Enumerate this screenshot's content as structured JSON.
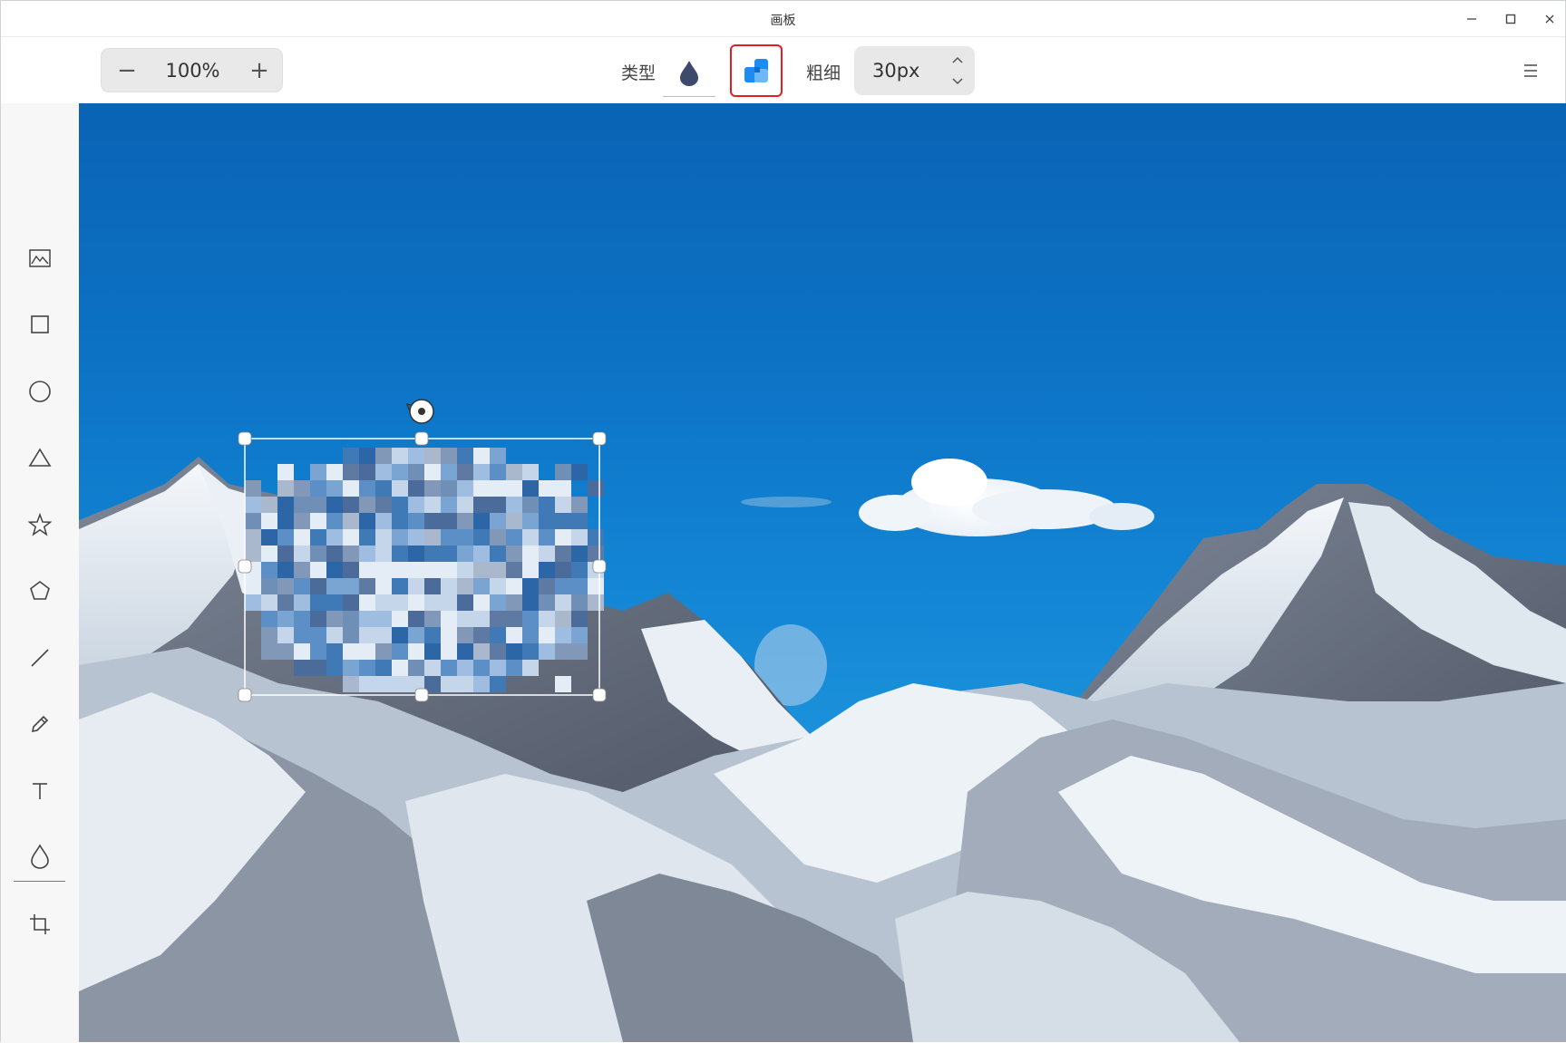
{
  "window": {
    "title": "画板",
    "controls": [
      "minimize-icon",
      "maximize-icon",
      "close-icon"
    ]
  },
  "toolbar": {
    "zoom_out": "−",
    "zoom_value": "100%",
    "zoom_in": "+",
    "type_label": "类型",
    "types": [
      {
        "name": "blur",
        "icon": "droplet-icon",
        "selected": false
      },
      {
        "name": "mosaic",
        "icon": "mosaic-icon",
        "selected": true
      }
    ],
    "thickness_label": "粗细",
    "thickness_value": "30px",
    "menu_icon": "hamburger-menu-icon"
  },
  "sidebar": {
    "tools": [
      {
        "name": "image",
        "icon": "image-icon"
      },
      {
        "name": "rectangle",
        "icon": "rectangle-icon"
      },
      {
        "name": "ellipse",
        "icon": "circle-icon"
      },
      {
        "name": "triangle",
        "icon": "triangle-icon"
      },
      {
        "name": "star",
        "icon": "star-icon"
      },
      {
        "name": "polygon",
        "icon": "pentagon-icon"
      },
      {
        "name": "line",
        "icon": "line-icon"
      },
      {
        "name": "pencil",
        "icon": "pencil-icon"
      },
      {
        "name": "text",
        "icon": "text-icon"
      },
      {
        "name": "blur",
        "icon": "droplet-icon"
      },
      {
        "name": "crop",
        "icon": "crop-icon"
      }
    ]
  },
  "colors": {
    "accent_red": "#e02020",
    "mosaic_blue": "#1c8cf0",
    "sky_top": "#0a63b5",
    "sky_bottom": "#3aa4e0"
  }
}
